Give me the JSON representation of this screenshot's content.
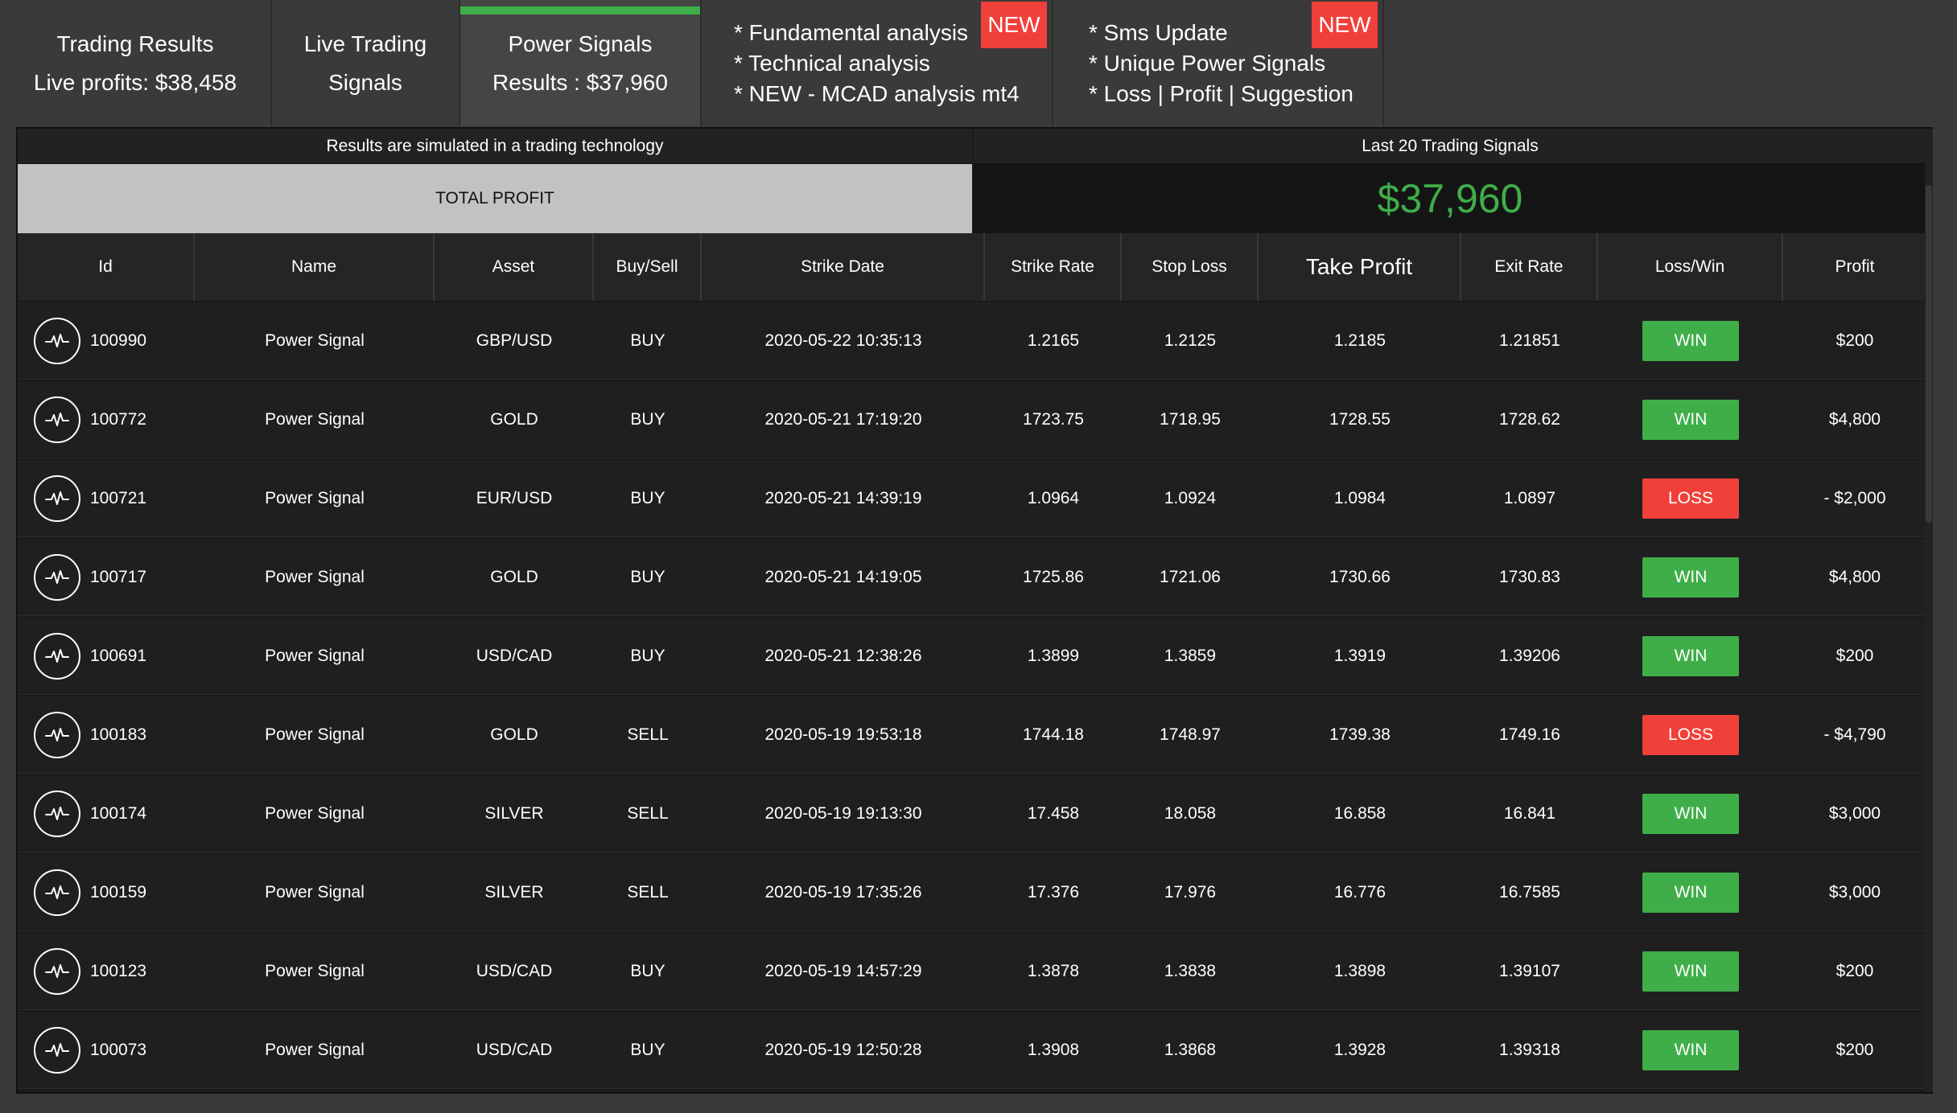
{
  "tabs": [
    {
      "line1": "Trading Results",
      "line2": "Live profits: $38,458"
    },
    {
      "line1": "Live Trading",
      "line2": "Signals"
    },
    {
      "line1": "Power Signals",
      "line2": "Results : $37,960"
    }
  ],
  "features": [
    {
      "lines": [
        "* Fundamental analysis",
        "* Technical analysis",
        "* NEW - MCAD analysis mt4"
      ],
      "badge": "NEW"
    },
    {
      "lines": [
        "* Sms Update",
        "* Unique Power Signals",
        "* Loss | Profit | Suggestion"
      ],
      "badge": "NEW"
    }
  ],
  "summary": {
    "left_header": "Results are simulated in a trading technology",
    "left_label": "TOTAL PROFIT",
    "right_header": "Last 20 Trading Signals",
    "right_value": "$37,960"
  },
  "colors": {
    "accent": "#3fae49",
    "win": "#3fae49",
    "loss": "#f0403a",
    "badge_new": "#f0403a"
  },
  "table": {
    "icon": "pulse-icon",
    "headers": [
      "Id",
      "Name",
      "Asset",
      "Buy/Sell",
      "Strike Date",
      "Strike Rate",
      "Stop Loss",
      "Take Profit",
      "Exit Rate",
      "Loss/Win",
      "Profit"
    ],
    "rows": [
      {
        "id": "100990",
        "name": "Power Signal",
        "asset": "GBP/USD",
        "side": "BUY",
        "date": "2020-05-22 10:35:13",
        "strike": "1.2165",
        "stop": "1.2125",
        "take": "1.2185",
        "exit": "1.21851",
        "result": "WIN",
        "profit": "$200"
      },
      {
        "id": "100772",
        "name": "Power Signal",
        "asset": "GOLD",
        "side": "BUY",
        "date": "2020-05-21 17:19:20",
        "strike": "1723.75",
        "stop": "1718.95",
        "take": "1728.55",
        "exit": "1728.62",
        "result": "WIN",
        "profit": "$4,800"
      },
      {
        "id": "100721",
        "name": "Power Signal",
        "asset": "EUR/USD",
        "side": "BUY",
        "date": "2020-05-21 14:39:19",
        "strike": "1.0964",
        "stop": "1.0924",
        "take": "1.0984",
        "exit": "1.0897",
        "result": "LOSS",
        "profit": "- $2,000"
      },
      {
        "id": "100717",
        "name": "Power Signal",
        "asset": "GOLD",
        "side": "BUY",
        "date": "2020-05-21 14:19:05",
        "strike": "1725.86",
        "stop": "1721.06",
        "take": "1730.66",
        "exit": "1730.83",
        "result": "WIN",
        "profit": "$4,800"
      },
      {
        "id": "100691",
        "name": "Power Signal",
        "asset": "USD/CAD",
        "side": "BUY",
        "date": "2020-05-21 12:38:26",
        "strike": "1.3899",
        "stop": "1.3859",
        "take": "1.3919",
        "exit": "1.39206",
        "result": "WIN",
        "profit": "$200"
      },
      {
        "id": "100183",
        "name": "Power Signal",
        "asset": "GOLD",
        "side": "SELL",
        "date": "2020-05-19 19:53:18",
        "strike": "1744.18",
        "stop": "1748.97",
        "take": "1739.38",
        "exit": "1749.16",
        "result": "LOSS",
        "profit": "- $4,790"
      },
      {
        "id": "100174",
        "name": "Power Signal",
        "asset": "SILVER",
        "side": "SELL",
        "date": "2020-05-19 19:13:30",
        "strike": "17.458",
        "stop": "18.058",
        "take": "16.858",
        "exit": "16.841",
        "result": "WIN",
        "profit": "$3,000"
      },
      {
        "id": "100159",
        "name": "Power Signal",
        "asset": "SILVER",
        "side": "SELL",
        "date": "2020-05-19 17:35:26",
        "strike": "17.376",
        "stop": "17.976",
        "take": "16.776",
        "exit": "16.7585",
        "result": "WIN",
        "profit": "$3,000"
      },
      {
        "id": "100123",
        "name": "Power Signal",
        "asset": "USD/CAD",
        "side": "BUY",
        "date": "2020-05-19 14:57:29",
        "strike": "1.3878",
        "stop": "1.3838",
        "take": "1.3898",
        "exit": "1.39107",
        "result": "WIN",
        "profit": "$200"
      },
      {
        "id": "100073",
        "name": "Power Signal",
        "asset": "USD/CAD",
        "side": "BUY",
        "date": "2020-05-19 12:50:28",
        "strike": "1.3908",
        "stop": "1.3868",
        "take": "1.3928",
        "exit": "1.39318",
        "result": "WIN",
        "profit": "$200"
      }
    ]
  }
}
